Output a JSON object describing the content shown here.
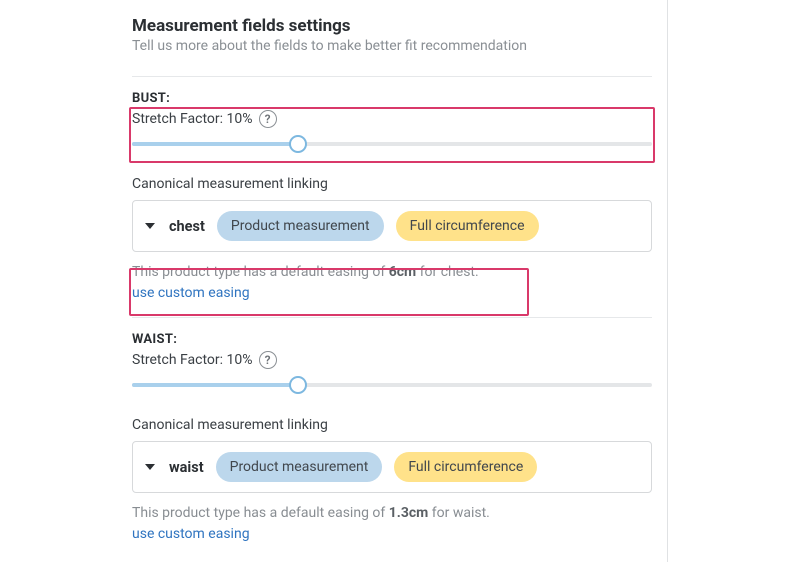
{
  "header": {
    "title": "Measurement fields settings",
    "subtitle": "Tell us more about the fields to make better fit recommendation"
  },
  "help_glyph": "?",
  "stretch_label_prefix": "Stretch Factor: ",
  "linking_heading": "Canonical measurement linking",
  "pill_product": "Product measurement",
  "pill_circ": "Full circumference",
  "easing_prefix": "This product type has a default easing of ",
  "easing_link": "use custom easing",
  "fields": {
    "bust": {
      "label": "BUST:",
      "stretch_value": "10%",
      "slider_pct": 32,
      "link_name": "chest",
      "easing_value": "6cm",
      "easing_suffix": " for chest."
    },
    "waist": {
      "label": "WAIST:",
      "stretch_value": "10%",
      "slider_pct": 32,
      "link_name": "waist",
      "easing_value": "1.3cm",
      "easing_suffix": " for waist."
    }
  }
}
